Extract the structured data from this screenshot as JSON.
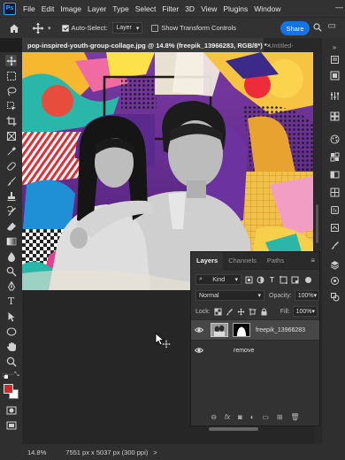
{
  "app": {
    "logo": "Ps"
  },
  "menu": [
    "File",
    "Edit",
    "Image",
    "Layer",
    "Type",
    "Select",
    "Filter",
    "3D",
    "View",
    "Plugins",
    "Window"
  ],
  "window_controls": "—",
  "options": {
    "auto_select_label": "Auto-Select:",
    "auto_select_checked": true,
    "auto_select_target": "Layer",
    "show_transform_label": "Show Transform Controls",
    "show_transform_checked": false,
    "share_label": "Share"
  },
  "tabs": [
    {
      "label": "pop-inspired-youth-group-collage.jpg @ 14.8% (freepik_13966283, RGB/8*) *",
      "close": "×"
    },
    {
      "label": "Untitled-"
    }
  ],
  "layers_panel": {
    "tabs": [
      "Layers",
      "Channels",
      "Paths"
    ],
    "filter_kind": "Kind",
    "blend_mode": "Normal",
    "opacity_label": "Opacity:",
    "opacity_value": "100%",
    "lock_label": "Lock:",
    "fill_label": "Fill:",
    "fill_value": "100%",
    "layers": [
      {
        "name": "freepik_13966283",
        "visible": true,
        "selected": true,
        "has_mask": true
      },
      {
        "name": "remove",
        "visible": true,
        "selected": false,
        "has_mask": false
      }
    ]
  },
  "status": {
    "zoom": "14.8%",
    "doc_info": "7551 px x 5037 px (300 ppi)",
    "arrow": ">"
  },
  "colors": {
    "foreground": "#d8222c",
    "background": "#ffffff",
    "accent": "#1473e6"
  }
}
